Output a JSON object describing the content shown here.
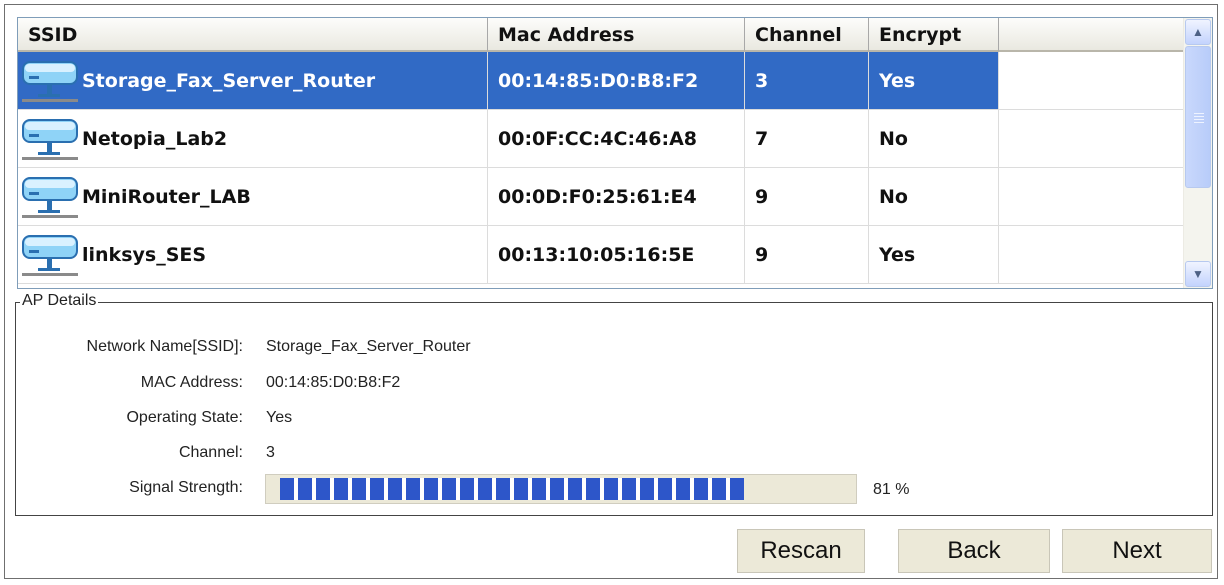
{
  "table": {
    "columns": [
      "SSID",
      "Mac Address",
      "Channel",
      "Encrypt",
      ""
    ],
    "rows": [
      {
        "ssid": "Storage_Fax_Server_Router",
        "mac": "00:14:85:D0:B8:F2",
        "channel": "3",
        "encrypt": "Yes",
        "selected": true
      },
      {
        "ssid": "Netopia_Lab2",
        "mac": "00:0F:CC:4C:46:A8",
        "channel": "7",
        "encrypt": "No",
        "selected": false
      },
      {
        "ssid": "MiniRouter_LAB",
        "mac": "00:0D:F0:25:61:E4",
        "channel": "9",
        "encrypt": "No",
        "selected": false
      },
      {
        "ssid": "linksys_SES",
        "mac": "00:13:10:05:16:5E",
        "channel": "9",
        "encrypt": "Yes",
        "selected": false
      }
    ],
    "row_icon": "wireless-router-icon",
    "selection_color": "#316ac5"
  },
  "details": {
    "legend": "AP Details",
    "network_name_label": "Network Name[SSID]:",
    "network_name_value": "Storage_Fax_Server_Router",
    "mac_label": "MAC Address:",
    "mac_value": "00:14:85:D0:B8:F2",
    "state_label": "Operating State:",
    "state_value": "Yes",
    "channel_label": "Channel:",
    "channel_value": "3",
    "signal_label": "Signal Strength:",
    "signal_value": 81,
    "signal_text": "81 %",
    "signal_color": "#2d56c9"
  },
  "buttons": {
    "rescan": "Rescan",
    "back": "Back",
    "next": "Next"
  }
}
